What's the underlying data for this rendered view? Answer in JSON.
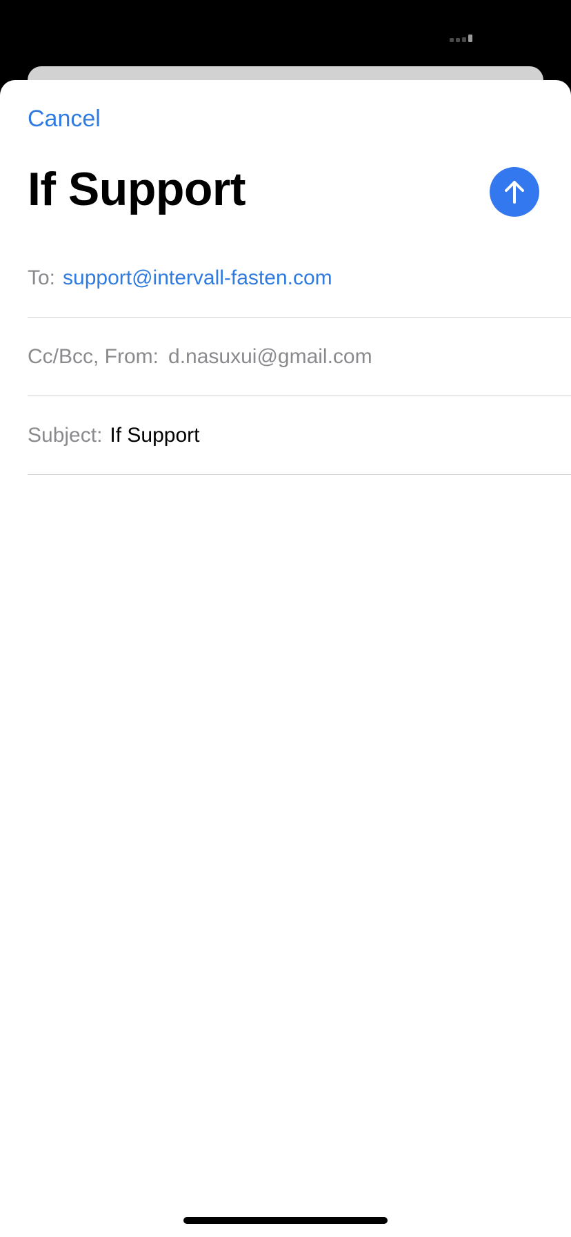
{
  "status_bar": {
    "signal_icon": "cellular-signal-icon"
  },
  "compose": {
    "cancel_label": "Cancel",
    "title": "If Support",
    "send_icon": "arrow-up-icon",
    "accent_color": "#2f7be0",
    "send_button_color": "#3478f0",
    "fields": {
      "to_label": "To:",
      "to_value": "support@intervall-fasten.com",
      "ccbcc_label": "Cc/Bcc, From:",
      "ccbcc_value": "d.nasuxui@gmail.com",
      "subject_label": "Subject:",
      "subject_value": "If Support"
    }
  }
}
